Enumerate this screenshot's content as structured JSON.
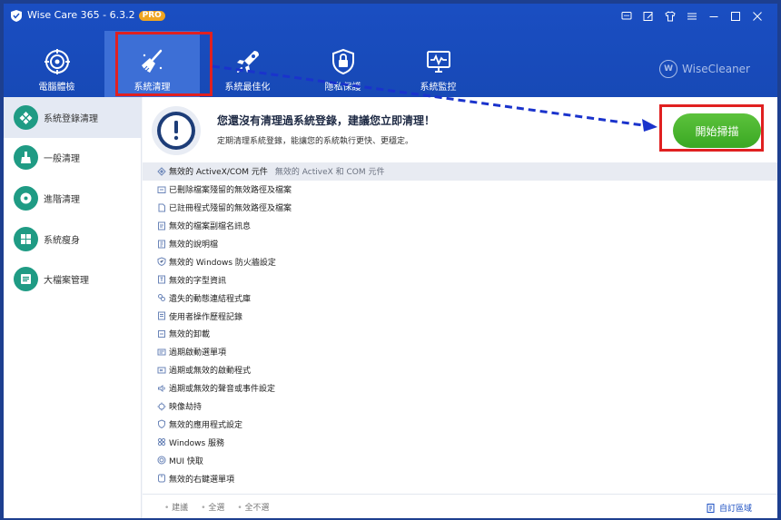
{
  "app": {
    "title": "Wise Care 365 - 6.3.2",
    "badge": "PRO"
  },
  "titlebar_icons": [
    "chat-icon",
    "edit-icon",
    "shirt-icon",
    "menu-icon",
    "minimize-icon",
    "maximize-icon",
    "close-icon"
  ],
  "nav": [
    {
      "label": "電腦體檢",
      "icon": "target-icon"
    },
    {
      "label": "系統清理",
      "icon": "broom-icon",
      "active": true
    },
    {
      "label": "系統最佳化",
      "icon": "rocket-icon"
    },
    {
      "label": "隱私保護",
      "icon": "lock-icon"
    },
    {
      "label": "系統監控",
      "icon": "monitor-icon"
    }
  ],
  "brand": {
    "mark": "W",
    "name": "WiseCleaner"
  },
  "sidebar": [
    {
      "label": "系統登錄清理",
      "icon": "registry-icon",
      "active": true
    },
    {
      "label": "一般清理",
      "icon": "broom-icon"
    },
    {
      "label": "進階清理",
      "icon": "disk-icon"
    },
    {
      "label": "系統瘦身",
      "icon": "windows-icon"
    },
    {
      "label": "大檔案管理",
      "icon": "file-icon"
    }
  ],
  "banner": {
    "title": "您還沒有清理過系統登錄，建議您立即清理！",
    "subtitle": "定期清理系統登錄，能讓您的系統執行更快、更穩定。",
    "scan_button": "開始掃描"
  },
  "list": [
    {
      "label": "無效的 ActiveX/COM 元件",
      "desc": "無效的 ActiveX 和 COM 元件"
    },
    {
      "label": "已刪除檔案殘留的無效路徑及檔案"
    },
    {
      "label": "已註冊程式殘留的無效路徑及檔案"
    },
    {
      "label": "無效的檔案副檔名訊息"
    },
    {
      "label": "無效的說明檔"
    },
    {
      "label": "無效的 Windows 防火牆設定"
    },
    {
      "label": "無效的字型資訊"
    },
    {
      "label": "遺失的動態連結程式庫"
    },
    {
      "label": "使用者操作歷程記錄"
    },
    {
      "label": "無效的卸載"
    },
    {
      "label": "過期啟動選單項"
    },
    {
      "label": "過期或無效的啟動程式"
    },
    {
      "label": "過期或無效的聲音或事件設定"
    },
    {
      "label": "映像劫持"
    },
    {
      "label": "無效的應用程式設定"
    },
    {
      "label": "Windows 服務"
    },
    {
      "label": "MUI 快取"
    },
    {
      "label": "無效的右鍵選單項"
    }
  ],
  "footer": {
    "recommended": "建議",
    "select_all": "全選",
    "select_none": "全不選",
    "custom": "自訂區域"
  },
  "colors": {
    "header": "#1a4ec2",
    "accent_green": "#3aa823",
    "highlight": "#e02020"
  }
}
